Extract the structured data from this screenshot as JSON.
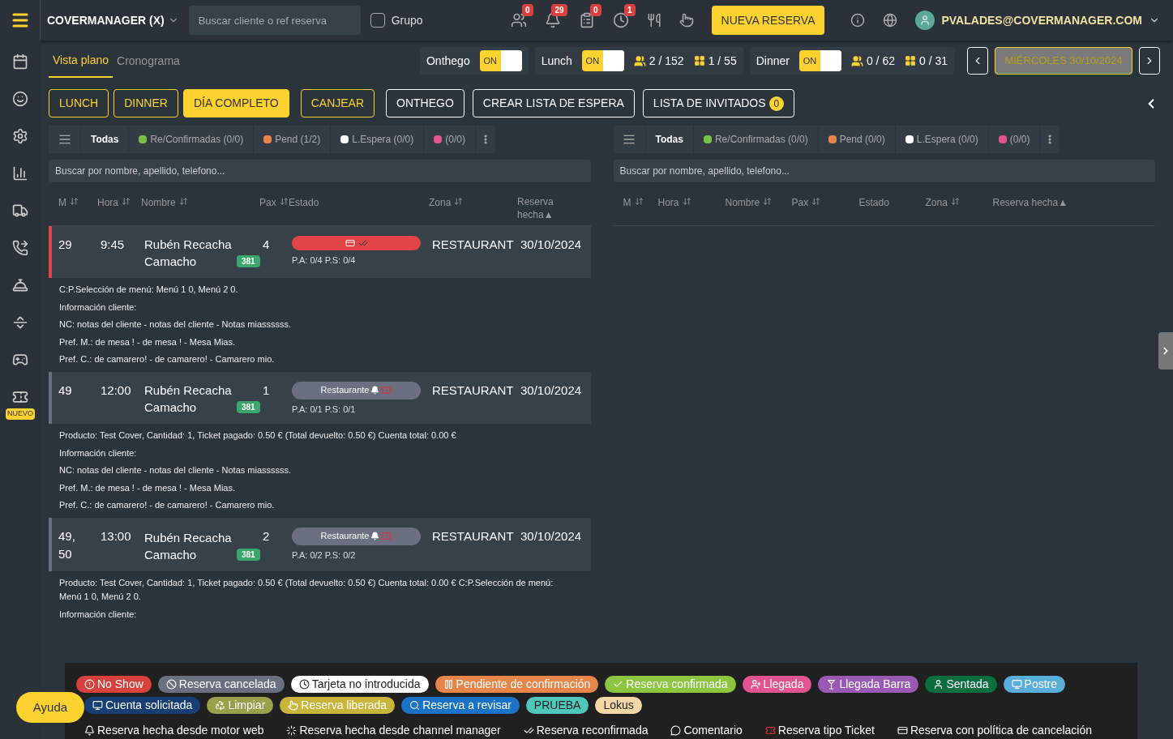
{
  "topbar": {
    "brand": "COVERMANAGER (X)",
    "search": {
      "placeholder": "Buscar cliente o ref reserva"
    },
    "group": {
      "label": "Grupo",
      "checked": false
    },
    "notifications": [
      {
        "count": "0"
      },
      {
        "count": "29"
      },
      {
        "count": "0"
      },
      {
        "count": "1"
      }
    ],
    "new_button": "NUEVA RESERVA",
    "user": "PVALADES@COVERMANAGER.COM"
  },
  "sidebar": {
    "badge": "NUEVO"
  },
  "view_tabs": [
    {
      "label": "Vista plano",
      "selected": true
    },
    {
      "label": "Cronograma",
      "selected": false
    }
  ],
  "services": [
    {
      "label": "Onthego",
      "switch": {
        "on": true,
        "text": "ON"
      }
    },
    {
      "label": "Lunch",
      "switch": {
        "on": true,
        "text": "ON"
      },
      "stats": [
        {
          "kind": "people",
          "text": "2 / 152"
        },
        {
          "kind": "tables",
          "text": "1 / 55"
        }
      ]
    },
    {
      "label": "Dinner",
      "switch": {
        "on": true,
        "text": "ON"
      },
      "stats": [
        {
          "kind": "people",
          "text": "0 / 62"
        },
        {
          "kind": "tables",
          "text": "0 / 31"
        }
      ]
    }
  ],
  "date": "MIÉRCOLES 30/10/2024",
  "shift_buttons": [
    {
      "label": "LUNCH",
      "selected": false
    },
    {
      "label": "DINNER",
      "selected": false
    },
    {
      "label": "DÍA COMPLETO",
      "selected": true
    },
    {
      "label": "CANJEAR",
      "selected": false
    }
  ],
  "action_buttons": [
    {
      "label": "ONTHEGO"
    },
    {
      "label": "CREAR LISTA DE ESPERA"
    },
    {
      "label": "LISTA DE INVITADOS",
      "count": "0"
    }
  ],
  "panels": [
    {
      "filters": [
        {
          "label": "Todas",
          "selected": true
        },
        {
          "label": "Re/Confirmadas (0/0)",
          "color": "#7cc242",
          "selected": false
        },
        {
          "label": "Pend (1/2)",
          "color": "#e8854a",
          "selected": false
        },
        {
          "label": "L.Espera (0/0)",
          "color": "#ffffff",
          "selected": false
        },
        {
          "label": "(0/0)",
          "color": "#e05590",
          "selected": false
        }
      ],
      "search_placeholder": "Buscar por nombre, apellido, telefono...",
      "columns": [
        {
          "label": "M",
          "sortable": true
        },
        {
          "label": "Hora",
          "sortable": true
        },
        {
          "label": "Nombre",
          "sortable": true
        },
        {
          "label": "Pax",
          "sortable": true
        },
        {
          "label": "Estado",
          "sortable": false
        },
        {
          "label": "Zona",
          "sortable": true
        },
        {
          "label": "Reserva hecha▲",
          "sortable": false
        }
      ],
      "rows": [
        {
          "m": "29",
          "time": "9:45",
          "name": "Rubén Recacha Camacho",
          "tag": "381",
          "pax": "4",
          "status": {
            "kind": "no_show",
            "color": "#e04444"
          },
          "pa_ps": "P.A: 0/4 P.S: 0/4",
          "zone": "RESTAURANT",
          "date": "30/10/2024",
          "color": "#e04444",
          "notes": [
            "C:P.Selección de menú: Menú 1 0, Menú 2 0.",
            "Información cliente:",
            "NC: notas del cliente - notas del cliente - Notas miassssss.",
            "Pref. M.: de mesa ! - de mesa ! - Mesa Mias.",
            "Pref. C.: de camarero! - de camarero! - Camarero mio."
          ]
        },
        {
          "m": "49",
          "time": "12:00",
          "name": "Rubén Recacha Camacho",
          "tag": "381",
          "pax": "1",
          "status": {
            "kind": "label",
            "text": "Restaurante",
            "color": "#6b7081"
          },
          "pa_ps": "P.A: 0/1 P.S: 0/1",
          "zone": "RESTAURANT",
          "date": "30/10/2024",
          "color": "#6b7081",
          "notes": [
            "Producto: Test Cover, Cantidad: 1, Ticket pagado: 0.50 € (Total devuelto: 0.50 €) Cuenta total: 0.00 €",
            "Información cliente:",
            "NC: notas del cliente - notas del cliente - Notas miassssss.",
            "Pref. M.: de mesa ! - de mesa ! - Mesa Mias.",
            "Pref. C.: de camarero! - de camarero! - Camarero mio."
          ]
        },
        {
          "m": "49, 50",
          "time": "13:00",
          "name": "Rubén Recacha Camacho",
          "tag": "381",
          "pax": "2",
          "status": {
            "kind": "label",
            "text": "Restaurante",
            "color": "#6b7081"
          },
          "pa_ps": "P.A: 0/2 P.S: 0/2",
          "zone": "RESTAURANT",
          "date": "30/10/2024",
          "color": "#6b7081",
          "notes": [
            "Producto: Test Cover, Cantidad: 1, Ticket pagado: 0.50 € (Total devuelto: 0.50 €) Cuenta total: 0.00 € C:P.Selección de menú: Menú 1 0, Menú 2 0.",
            "Información cliente:"
          ]
        }
      ]
    },
    {
      "filters": [
        {
          "label": "Todas",
          "selected": true
        },
        {
          "label": "Re/Confirmadas (0/0)",
          "color": "#7cc242",
          "selected": false
        },
        {
          "label": "Pend (0/0)",
          "color": "#e8854a",
          "selected": false
        },
        {
          "label": "L.Espera (0/0)",
          "color": "#ffffff",
          "selected": false
        },
        {
          "label": "(0/0)",
          "color": "#e05590",
          "selected": false
        }
      ],
      "search_placeholder": "Buscar por nombre, apellido, telefono...",
      "columns": [
        {
          "label": "M",
          "sortable": true
        },
        {
          "label": "Hora",
          "sortable": true
        },
        {
          "label": "Nombre",
          "sortable": true
        },
        {
          "label": "Pax",
          "sortable": true
        },
        {
          "label": "Estado",
          "sortable": false
        },
        {
          "label": "Zona",
          "sortable": true
        },
        {
          "label": "Reserva hecha▲",
          "sortable": false
        }
      ]
    }
  ],
  "legend": [
    {
      "label": "No Show",
      "kind": "pill",
      "color": "#d9413f"
    },
    {
      "label": "Reserva cancelada",
      "kind": "pill",
      "color": "#6b7081"
    },
    {
      "label": "Tarjeta no introducida",
      "kind": "pill",
      "color": "#ffffff"
    },
    {
      "label": "Pendiente de confirmación",
      "kind": "pill",
      "color": "#e8854a"
    },
    {
      "label": "Reserva confirmada",
      "kind": "pill",
      "color": "#8cc63f"
    },
    {
      "label": "Llegada",
      "kind": "pill",
      "color": "#e05590"
    },
    {
      "label": "Llegada Barra",
      "kind": "pill",
      "color": "#9b59b6"
    },
    {
      "label": "Sentada",
      "kind": "pill",
      "color": "#0b6e3f"
    },
    {
      "label": "Postre",
      "kind": "pill",
      "color": "#5aaedc"
    },
    {
      "label": "Cuenta solicitada",
      "kind": "pill",
      "color": "#153e75"
    },
    {
      "label": "Limpiar",
      "kind": "pill",
      "color": "#9aa04a"
    },
    {
      "label": "Reserva liberada",
      "kind": "pill",
      "color": "#c9b53a"
    },
    {
      "label": "Reserva a revisar",
      "kind": "pill",
      "color": "#1a73c9"
    },
    {
      "label": "PRUEBA",
      "kind": "pill",
      "color": "#4fc7bb"
    },
    {
      "label": "Lokus",
      "kind": "pill",
      "color": "#f4d7a6"
    },
    {
      "label": "Reserva hecha desde motor web",
      "kind": "plain"
    },
    {
      "label": "Reserva hecha desde channel manager",
      "kind": "plain"
    },
    {
      "label": "Reserva reconfirmada",
      "kind": "plain"
    },
    {
      "label": "Comentario",
      "kind": "plain"
    },
    {
      "label": "Reserva tipo Ticket",
      "kind": "plain"
    },
    {
      "label": "Reserva con política de cancelación",
      "kind": "plain"
    }
  ],
  "help_button": "Ayuda"
}
